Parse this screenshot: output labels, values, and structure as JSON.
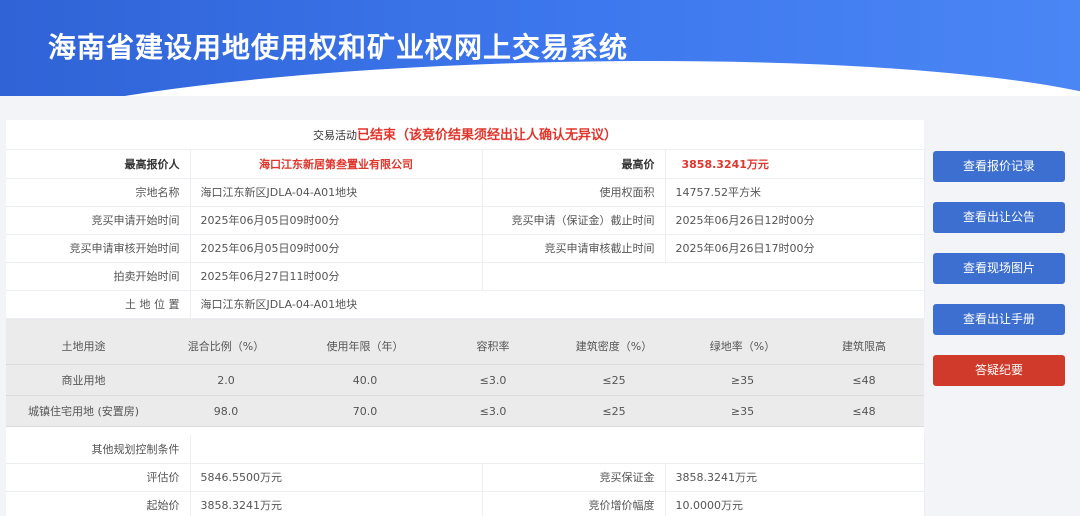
{
  "header": {
    "title": "海南省建设用地使用权和矿业权网上交易系统"
  },
  "status": {
    "label": "交易活动",
    "value": "已结束（该竞价结果须经出让人确认无异议）"
  },
  "info": {
    "top_bidder_label": "最高报价人",
    "top_bidder_value": "海口江东新居第叁置业有限公司",
    "top_price_label": "最高价",
    "top_price_value": "3858.3241万元",
    "parcel_name_label": "宗地名称",
    "parcel_name_value": "海口江东新区JDLA-04-A01地块",
    "area_label": "使用权面积",
    "area_value": "14757.52平方米",
    "apply_start_label": "竞买申请开始时间",
    "apply_start_value": "2025年06月05日09时00分",
    "deposit_deadline_label": "竞买申请（保证金）截止时间",
    "deposit_deadline_value": "2025年06月26日12时00分",
    "review_start_label": "竞买申请审核开始时间",
    "review_start_value": "2025年06月05日09时00分",
    "review_deadline_label": "竞买申请审核截止时间",
    "review_deadline_value": "2025年06月26日17时00分",
    "auction_start_label": "拍卖开始时间",
    "auction_start_value": "2025年06月27日11时00分",
    "location_label": "土 地 位 置",
    "location_value": "海口江东新区JDLA-04-A01地块"
  },
  "land_use": {
    "headers": [
      "土地用途",
      "混合比例（%）",
      "使用年限（年）",
      "容积率",
      "建筑密度（%）",
      "绿地率（%）",
      "建筑限高"
    ],
    "rows": [
      [
        "商业用地",
        "2.0",
        "40.0",
        "≤3.0",
        "≤25",
        "≥35",
        "≤48"
      ],
      [
        "城镇住宅用地 (安置房)",
        "98.0",
        "70.0",
        "≤3.0",
        "≤25",
        "≥35",
        "≤48"
      ]
    ]
  },
  "bottom": {
    "other_label": "其他规划控制条件",
    "other_value": "",
    "appraisal_label": "评估价",
    "appraisal_value": "5846.5500万元",
    "deposit_label": "竞买保证金",
    "deposit_value": "3858.3241万元",
    "start_price_label": "起始价",
    "start_price_value": "3858.3241万元",
    "increment_label": "竞价增价幅度",
    "increment_value": "10.0000万元"
  },
  "actions": {
    "bid_records": "查看报价记录",
    "announcement": "查看出让公告",
    "site_photos": "查看现场图片",
    "manual": "查看出让手册",
    "qa": "答疑纪要"
  },
  "colors": {
    "accent": "#3d6fd0",
    "danger": "#cf3a2a",
    "highlight_text": "#e0352b"
  }
}
